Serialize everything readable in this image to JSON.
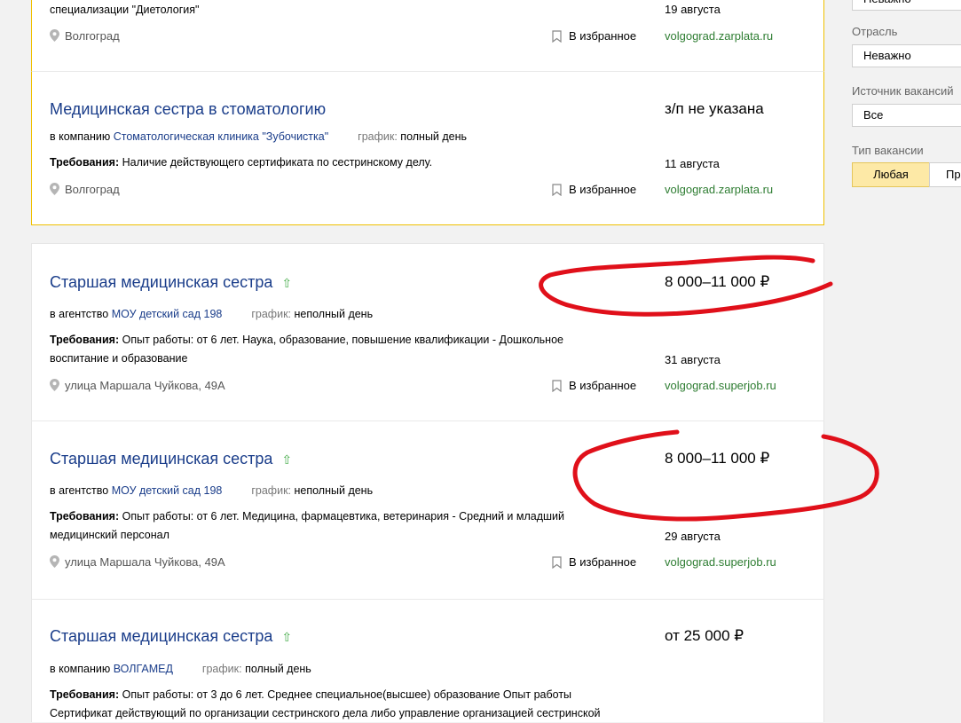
{
  "vacancies": [
    {
      "title": "",
      "salary": "",
      "req_tail": "специализации \"Диетология\"",
      "location": "Волгоград",
      "favorite": "В избранное",
      "date": "19 августа",
      "source": "volgograd.zarplata.ru"
    },
    {
      "title": "Медицинская сестра в стоматологию",
      "salary": "з/п не указана",
      "employer_prefix": "в компанию",
      "employer": "Стоматологическая клиника \"Зубочистка\"",
      "schedule_label": "график:",
      "schedule": "полный день",
      "req_label": "Требования:",
      "req": "Наличие действующего сертификата по сестринскому делу.",
      "location": "Волгоград",
      "favorite": "В избранное",
      "date": "11 августа",
      "source": "volgograd.zarplata.ru"
    },
    {
      "title": "Старшая медицинская сестра",
      "salary": "8 000–11 000 ₽",
      "employer_prefix": "в агентство",
      "employer": "МОУ детский сад 198",
      "schedule_label": "график:",
      "schedule": "неполный день",
      "req_label": "Требования:",
      "req": "Опыт работы: от 6 лет. Наука, образование, повышение квалификации - Дошкольное воспитание и образование",
      "location": "улица Маршала Чуйкова, 49А",
      "favorite": "В избранное",
      "date": "31 августа",
      "source": "volgograd.superjob.ru"
    },
    {
      "title": "Старшая медицинская сестра",
      "salary": "8 000–11 000 ₽",
      "employer_prefix": "в агентство",
      "employer": "МОУ детский сад 198",
      "schedule_label": "график:",
      "schedule": "неполный день",
      "req_label": "Требования:",
      "req": "Опыт работы: от 6 лет. Медицина, фармацевтика, ветеринария - Средний и младший медицинский персонал",
      "location": "улица Маршала Чуйкова, 49А",
      "favorite": "В избранное",
      "date": "29 августа",
      "source": "volgograd.superjob.ru"
    },
    {
      "title": "Старшая медицинская сестра",
      "salary": "от 25 000 ₽",
      "employer_prefix": "в компанию",
      "employer": "ВОЛГАМЕД",
      "schedule_label": "график:",
      "schedule": "полный день",
      "req_label": "Требования:",
      "req": "Опыт работы: от 3 до 6 лет. Среднее специальное(высшее) образование Опыт работы Сертификат действующий по организации сестринского дела либо управление организацией сестринской"
    }
  ],
  "sidebar": {
    "top_select": "Неважно",
    "industry_label": "Отрасль",
    "industry_value": "Неважно",
    "source_label": "Источник вакансий",
    "source_value": "Все",
    "type_label": "Тип вакансии",
    "type_active": "Любая",
    "type_other": "Пр"
  },
  "colors": {
    "title": "#1a3d8a",
    "source": "#2e7d32",
    "highlight_border": "#f0c000",
    "annotation": "#e0101a"
  }
}
